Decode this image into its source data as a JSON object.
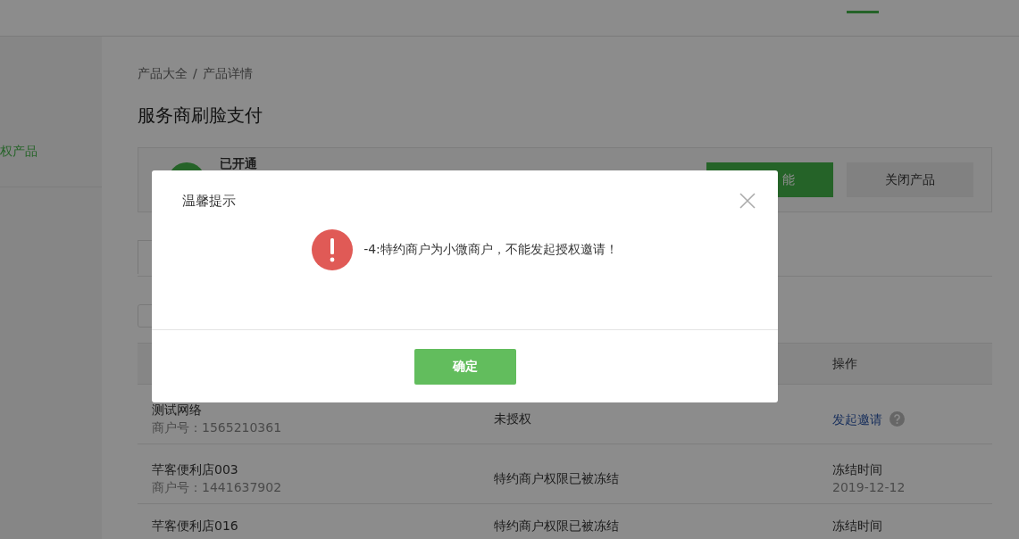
{
  "sidebar": {
    "items": [
      {
        "label": "权产品",
        "selected": true
      }
    ]
  },
  "breadcrumb": {
    "items": [
      "产品大全",
      "产品详情"
    ],
    "separator": "/"
  },
  "title": "服务商刷脸支付",
  "status_card": {
    "status": "已开通",
    "buttons": [
      {
        "label": "能",
        "kind": "primary"
      },
      {
        "label": "关闭产品",
        "kind": "default"
      }
    ]
  },
  "table": {
    "columns": [
      "操作"
    ],
    "rows": [
      {
        "name": "测试网络",
        "merchant_id": "商户号：1565210361",
        "status": "未授权",
        "action": {
          "kind": "link",
          "label": "发起邀请"
        }
      },
      {
        "name": "芊客便利店003",
        "merchant_id": "商户号：1441637902",
        "status": "特约商户权限已被冻结",
        "action": {
          "kind": "text",
          "label": "冻结时间",
          "detail": "2019-12-12"
        }
      },
      {
        "name": "芊客便利店016",
        "status": "特约商户权限已被冻结",
        "action": {
          "kind": "text",
          "label": "冻结时间"
        }
      }
    ]
  },
  "dialog": {
    "title": "温馨提示",
    "message": "-4:特约商户为小微商户，不能发起授权邀请！",
    "confirm": "确定"
  }
}
